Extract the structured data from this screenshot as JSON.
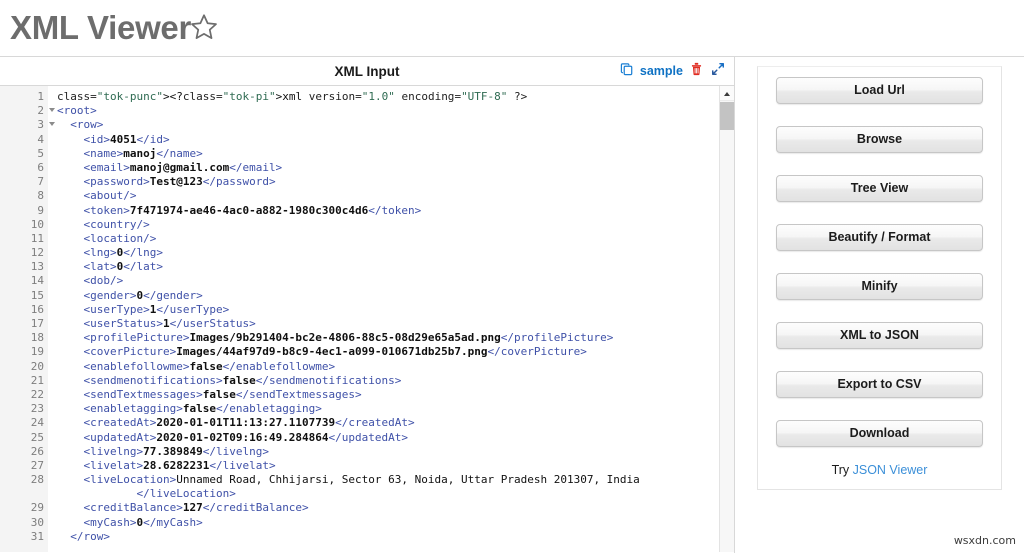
{
  "app": {
    "title": "XML Viewer",
    "star_icon": "star-outline-icon",
    "watermark": "wsxdn.com"
  },
  "editor": {
    "header_title": "XML Input",
    "actions": {
      "copy_icon": "copy-icon",
      "sample_label": "sample",
      "trash_icon": "trash-icon",
      "expand_icon": "expand-arrows-icon"
    },
    "scrollbar": {
      "up_arrow_icon": "chevron-up-icon"
    },
    "line_numbers": [
      1,
      2,
      3,
      4,
      5,
      6,
      7,
      8,
      9,
      10,
      11,
      12,
      13,
      14,
      15,
      16,
      17,
      18,
      19,
      20,
      21,
      22,
      23,
      24,
      25,
      26,
      27,
      28,
      29,
      30,
      31
    ],
    "folded_lines": [
      2,
      3
    ],
    "code_lines": [
      "<?xml version=\"1.0\" encoding=\"UTF-8\" ?>",
      "<root>",
      "  <row>",
      "    <id>4051</id>",
      "    <name>manoj</name>",
      "    <email>manoj@gmail.com</email>",
      "    <password>Test@123</password>",
      "    <about/>",
      "    <token>7f471974-ae46-4ac0-a882-1980c300c4d6</token>",
      "    <country/>",
      "    <location/>",
      "    <lng>0</lng>",
      "    <lat>0</lat>",
      "    <dob/>",
      "    <gender>0</gender>",
      "    <userType>1</userType>",
      "    <userStatus>1</userStatus>",
      "    <profilePicture>Images/9b291404-bc2e-4806-88c5-08d29e65a5ad.png</profilePicture>",
      "    <coverPicture>Images/44af97d9-b8c9-4ec1-a099-010671db25b7.png</coverPicture>",
      "    <enablefollowme>false</enablefollowme>",
      "    <sendmenotifications>false</sendmenotifications>",
      "    <sendTextmessages>false</sendTextmessages>",
      "    <enabletagging>false</enabletagging>",
      "    <createdAt>2020-01-01T11:13:27.1107739</createdAt>",
      "    <updatedAt>2020-01-02T09:16:49.284864</updatedAt>",
      "    <livelng>77.389849</livelng>",
      "    <livelat>28.6282231</livelat>",
      "    <liveLocation>Unnamed Road, Chhijarsi, Sector 63, Noida, Uttar Pradesh 201307, India</liveLocation>",
      "    <creditBalance>127</creditBalance>",
      "    <myCash>0</myCash>",
      "  </row>"
    ]
  },
  "sidebar": {
    "buttons": [
      {
        "label": "Load Url"
      },
      {
        "label": "Browse"
      },
      {
        "label": "Tree View"
      },
      {
        "label": "Beautify / Format"
      },
      {
        "label": "Minify"
      },
      {
        "label": "XML to JSON"
      },
      {
        "label": "Export to CSV"
      },
      {
        "label": "Download"
      }
    ],
    "try_prefix": "Try ",
    "try_link_label": "JSON Viewer"
  },
  "colors": {
    "link_blue": "#0f72c4",
    "try_link_blue": "#3b8fd8",
    "tag_blue": "#3f51a8",
    "trash_red": "#e02b20",
    "title_gray": "#6d6d6d"
  }
}
